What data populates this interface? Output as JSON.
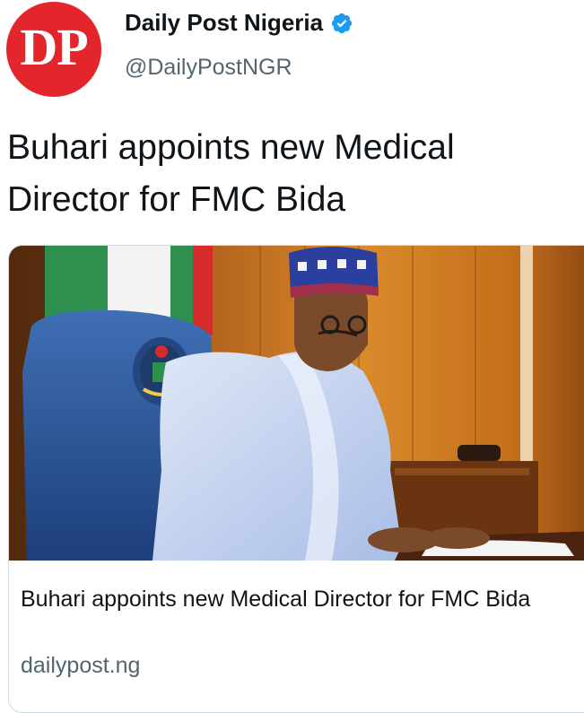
{
  "author": {
    "avatar_text": "DP",
    "display_name": "Daily Post Nigeria",
    "handle": "@DailyPostNGR",
    "verified": true,
    "avatar_color": "#e2262b",
    "verified_icon": "verified-badge-icon"
  },
  "tweet": {
    "text": "Buhari appoints new Medical Director for FMC Bida"
  },
  "link_card": {
    "title": "Buhari appoints new Medical Director for FMC Bida",
    "domain": "dailypost.ng",
    "image_subject": "man in white robe and embroidered cap seated at desk before flag"
  },
  "colors": {
    "text_primary": "#0f1419",
    "text_secondary": "#536471",
    "verified_blue": "#1d9bf0",
    "card_border": "#cfd9de"
  }
}
